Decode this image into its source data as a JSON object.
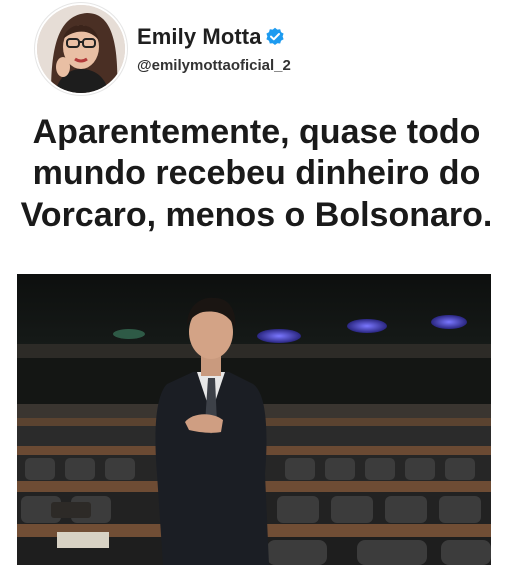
{
  "author": {
    "name": "Emily Motta",
    "handle": "@emilymottaoficial_2",
    "verified": true,
    "avatar_icon": "profile-photo-avatar",
    "verified_icon": "verified-badge-icon",
    "verified_color": "#1d9bf0"
  },
  "post": {
    "text_lines": [
      "Aparentemente, quase todo",
      "mundo recebeu dinheiro do",
      "Vorcaro, menos o Bolsonaro."
    ],
    "image_icon": "photo-man-in-suit-hand-on-chest-in-parliament-chamber"
  },
  "colors": {
    "text": "#1a1a1a",
    "background": "#ffffff",
    "chair_dark": "#2a2a2a",
    "desk_wood": "#6b4a33",
    "ceiling_light": "#5a56ff"
  }
}
